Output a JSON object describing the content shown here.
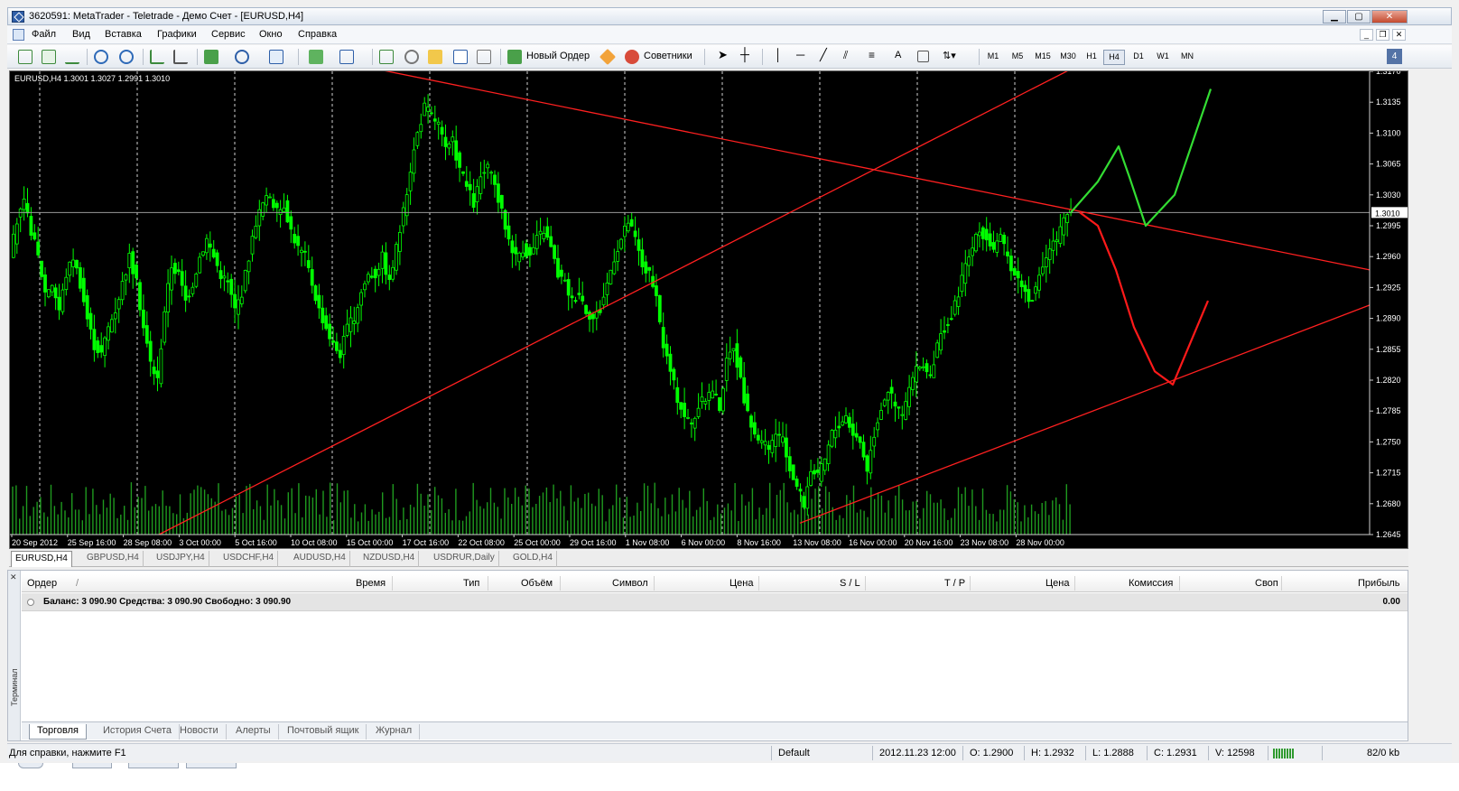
{
  "window": {
    "title": "3620591: MetaTrader - Teletrade - Демо Счет - [EURUSD,H4]",
    "min_icon": "minimize-icon",
    "max_icon": "maximize-icon",
    "close_icon": "close-icon"
  },
  "menu": {
    "items": [
      "Файл",
      "Вид",
      "Вставка",
      "Графики",
      "Сервис",
      "Окно",
      "Справка"
    ]
  },
  "toolbar": {
    "new_order_label": "Новый Ордер",
    "experts_label": "Советники",
    "text_tool": "A",
    "timeframes": [
      "M1",
      "M5",
      "M15",
      "M30",
      "H1",
      "H4",
      "D1",
      "W1",
      "MN"
    ],
    "active_timeframe": "H4",
    "notification_count": "4"
  },
  "chart": {
    "symbol_label": "EURUSD,H4  1.3001 1.3027 1.2991 1.3010",
    "current_price": "1.3010",
    "colors": {
      "background": "#000000",
      "candle": "#00ff00",
      "volume": "#1f9a1f",
      "trendline": "#ff2020",
      "forecast_up": "#33dd33",
      "forecast_down": "#ff1a1a"
    }
  },
  "chart_data": {
    "type": "candlestick",
    "symbol": "EURUSD",
    "timeframe": "H4",
    "ylim": [
      1.2645,
      1.317
    ],
    "y_ticks": [
      "1.3170",
      "1.3135",
      "1.3100",
      "1.3065",
      "1.3030",
      "1.2995",
      "1.2960",
      "1.2925",
      "1.2890",
      "1.2855",
      "1.2820",
      "1.2785",
      "1.2750",
      "1.2715",
      "1.2680",
      "1.2645"
    ],
    "x_ticks": [
      "20 Sep 2012",
      "25 Sep 16:00",
      "28 Sep 08:00",
      "3 Oct 00:00",
      "5 Oct 16:00",
      "10 Oct 08:00",
      "15 Oct 00:00",
      "17 Oct 16:00",
      "22 Oct 08:00",
      "25 Oct 00:00",
      "29 Oct 16:00",
      "1 Nov 08:00",
      "6 Nov 00:00",
      "8 Nov 16:00",
      "13 Nov 08:00",
      "16 Nov 00:00",
      "20 Nov 16:00",
      "23 Nov 08:00",
      "28 Nov 00:00"
    ],
    "price_path": [
      1.296,
      1.3,
      1.302,
      1.299,
      1.296,
      1.292,
      1.293,
      1.29,
      1.294,
      1.296,
      1.293,
      1.289,
      1.286,
      1.285,
      1.288,
      1.29,
      1.293,
      1.296,
      1.293,
      1.288,
      1.284,
      1.282,
      1.29,
      1.295,
      1.294,
      1.291,
      1.293,
      1.296,
      1.298,
      1.296,
      1.294,
      1.293,
      1.29,
      1.292,
      1.296,
      1.3,
      1.302,
      1.303,
      1.301,
      1.302,
      1.299,
      1.297,
      1.296,
      1.293,
      1.29,
      1.288,
      1.286,
      1.285,
      1.288,
      1.289,
      1.292,
      1.294,
      1.294,
      1.296,
      1.293,
      1.297,
      1.301,
      1.306,
      1.31,
      1.313,
      1.312,
      1.311,
      1.308,
      1.309,
      1.306,
      1.304,
      1.302,
      1.305,
      1.306,
      1.304,
      1.301,
      1.298,
      1.296,
      1.297,
      1.296,
      1.298,
      1.299,
      1.297,
      1.294,
      1.293,
      1.291,
      1.292,
      1.29,
      1.289,
      1.29,
      1.293,
      1.296,
      1.298,
      1.3,
      1.298,
      1.295,
      1.294,
      1.291,
      1.286,
      1.283,
      1.28,
      1.278,
      1.277,
      1.279,
      1.28,
      1.281,
      1.279,
      1.284,
      1.286,
      1.282,
      1.278,
      1.276,
      1.275,
      1.274,
      1.276,
      1.275,
      1.272,
      1.27,
      1.268,
      1.272,
      1.271,
      1.273,
      1.276,
      1.277,
      1.278,
      1.276,
      1.275,
      1.272,
      1.276,
      1.279,
      1.281,
      1.279,
      1.278,
      1.281,
      1.283,
      1.284,
      1.282,
      1.286,
      1.288,
      1.289,
      1.292,
      1.295,
      1.297,
      1.299,
      1.298,
      1.297,
      1.298,
      1.296,
      1.294,
      1.293,
      1.291,
      1.292,
      1.295,
      1.297,
      1.298,
      1.3,
      1.301
    ],
    "volume_range": [
      0.25,
      1.0
    ],
    "vertical_separators": 11,
    "trendlines": [
      {
        "from": [
          "20 Sep 2012",
          1.318
        ],
        "to": [
          "28 Nov 00:00",
          1.2945
        ]
      },
      {
        "from": [
          "28 Sep 08:00",
          1.2645
        ],
        "to": [
          "28 Nov 00:00",
          1.3175
        ]
      },
      {
        "from": [
          "13 Nov 08:00",
          1.2658
        ],
        "to": [
          "28 Nov 00:00",
          1.2905
        ]
      }
    ],
    "forecast_up": [
      1.301,
      1.3045,
      1.3085,
      1.305,
      1.2995,
      1.303,
      1.315
    ],
    "forecast_down": [
      1.301,
      1.2995,
      1.2945,
      1.288,
      1.283,
      1.2815,
      1.291
    ]
  },
  "chart_tabs": [
    "EURUSD,H4",
    "GBPUSD,H4",
    "USDJPY,H4",
    "USDCHF,H4",
    "AUDUSD,H4",
    "NZDUSD,H4",
    "USDRUR,Daily",
    "GOLD,H4"
  ],
  "terminal": {
    "side_label": "Терминал",
    "columns": {
      "order": "Ордер",
      "sort_mark": "/",
      "time": "Время",
      "type": "Тип",
      "volume": "Объём",
      "symbol": "Символ",
      "price": "Цена",
      "sl": "S / L",
      "tp": "T / P",
      "price2": "Цена",
      "commission": "Комиссия",
      "swap": "Своп",
      "profit": "Прибыль"
    },
    "balance_text": "Баланс: 3 090.90  Средства: 3 090.90  Свободно: 3 090.90",
    "balance_profit": "0.00",
    "tabs": [
      "Торговля",
      "История Счета",
      "Новости",
      "Алерты",
      "Почтовый ящик",
      "Журнал"
    ]
  },
  "statusbar": {
    "help": "Для справки, нажмите F1",
    "profile": "Default",
    "datetime": "2012.11.23 12:00",
    "open": "O: 1.2900",
    "high": "H: 1.2932",
    "low": "L: 1.2888",
    "close": "C: 1.2931",
    "volume": "V: 12598",
    "traffic": "82/0 kb"
  }
}
